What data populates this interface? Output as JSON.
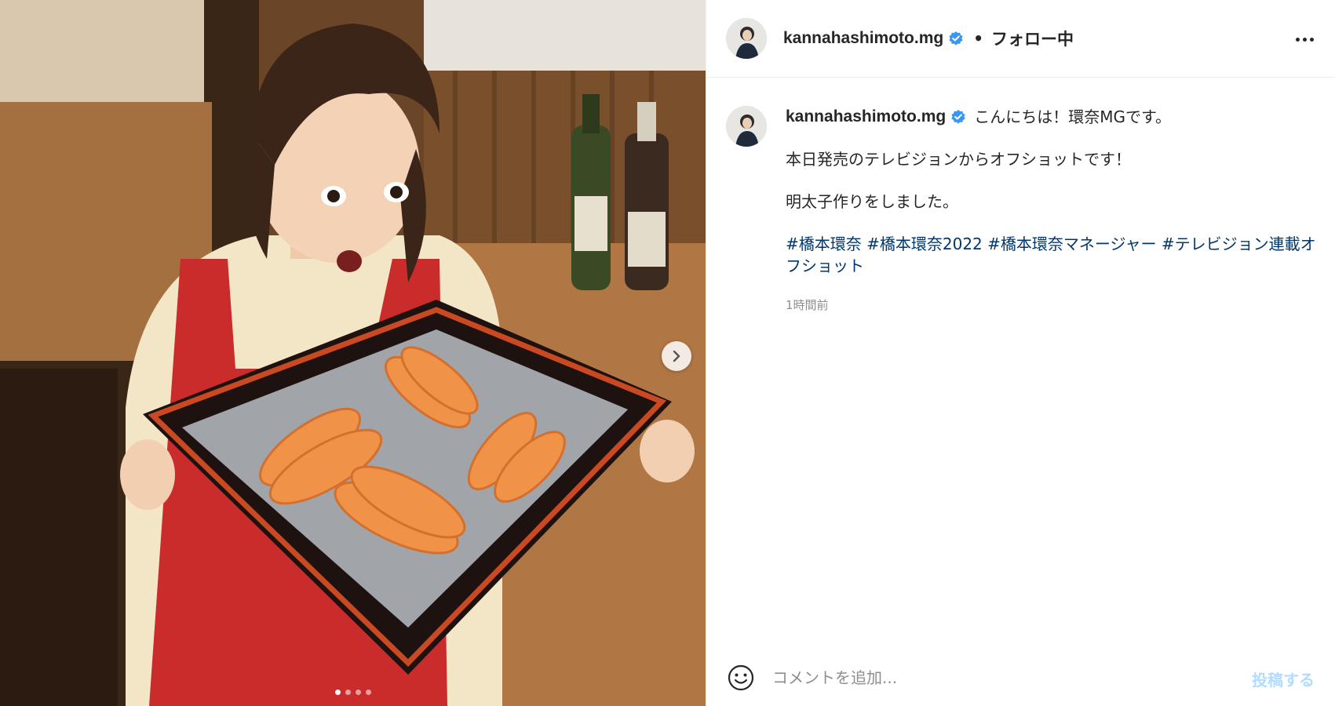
{
  "header": {
    "username": "kannahashimoto.mg",
    "separator": "•",
    "follow_status": "フォロー中"
  },
  "caption": {
    "username": "kannahashimoto.mg",
    "line1": "こんにちは！環奈MGです。",
    "line2": "本日発売のテレビジョンからオフショットです！",
    "line3": "明太子作りをしました。",
    "hashtags": [
      "#橋本環奈",
      "#橋本環奈2022",
      "#橋本環奈マネージャー",
      "#テレビジョン連載オフショット"
    ],
    "time": "1時間前"
  },
  "comment": {
    "placeholder": "コメントを追加...",
    "post_label": "投稿する"
  },
  "media": {
    "carousel_count": 4,
    "active_index": 0
  },
  "colors": {
    "verified": "#3897f0",
    "hashtag": "#00376b",
    "post_disabled": "#b3dbff",
    "text": "#262626",
    "muted": "#8e8e8e"
  },
  "icons": [
    "verified-badge-icon",
    "more-options-icon",
    "chevron-right-icon",
    "emoji-icon"
  ]
}
